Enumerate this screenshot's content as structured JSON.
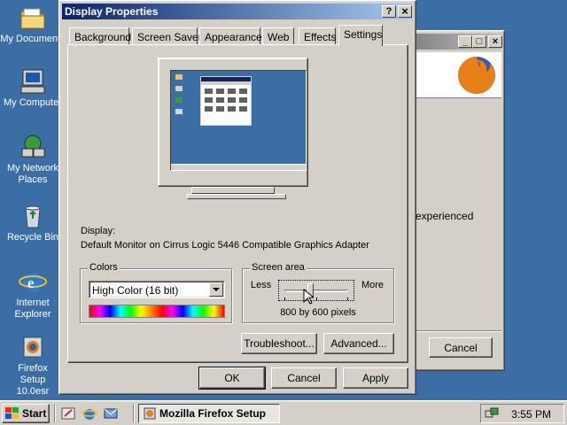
{
  "desktop": {
    "icons": [
      {
        "label": "My Documents"
      },
      {
        "label": "My Computer"
      },
      {
        "label": "My Network Places"
      },
      {
        "label": "Recycle Bin"
      },
      {
        "label": "Internet Explorer"
      },
      {
        "label": "Firefox Setup 10.0esr"
      }
    ]
  },
  "bg_window": {
    "text": "experienced",
    "cancel_label": "Cancel"
  },
  "dialog": {
    "title": "Display Properties",
    "help_btn": "?",
    "close_btn": "×",
    "tabs": [
      "Background",
      "Screen Saver",
      "Appearance",
      "Web",
      "Effects",
      "Settings"
    ],
    "active_tab": "Settings",
    "display_label": "Display:",
    "display_value": "Default Monitor on Cirrus Logic 5446 Compatible Graphics Adapter",
    "colors": {
      "group_label": "Colors",
      "selected": "High Color (16 bit)"
    },
    "screen_area": {
      "group_label": "Screen area",
      "less": "Less",
      "more": "More",
      "resolution": "800 by 600 pixels",
      "slider_level": 0.4
    },
    "troubleshoot_label": "Troubleshoot...",
    "advanced_label": "Advanced...",
    "ok_label": "OK",
    "cancel_label": "Cancel",
    "apply_label": "Apply"
  },
  "taskbar": {
    "start_label": "Start",
    "task_label": "Mozilla Firefox Setup",
    "clock": "3:55 PM"
  },
  "colors": {
    "desktop": "#3a6ea5",
    "titlebar_start": "#0a246a",
    "titlebar_end": "#a6caf0",
    "face": "#d4d0c8"
  }
}
